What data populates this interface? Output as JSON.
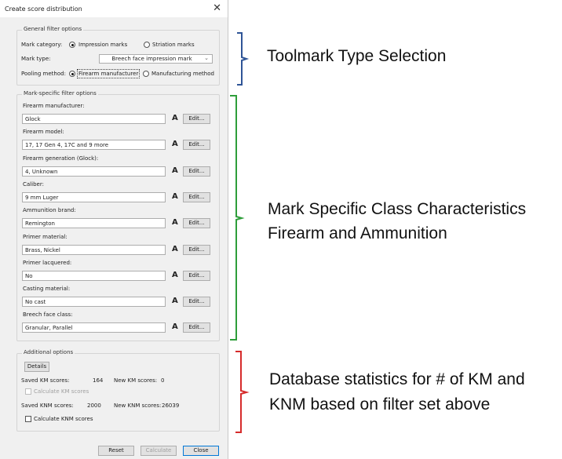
{
  "dialog": {
    "title": "Create score distribution",
    "general": {
      "legend": "General filter options",
      "mark_category_label": "Mark category:",
      "mark_category_options": [
        "Impression marks",
        "Striation marks"
      ],
      "mark_type_label": "Mark type:",
      "mark_type_value": "Breech face impression mark",
      "pooling_label": "Pooling method:",
      "pooling_options": [
        "Firearm manufacturer",
        "Manufacturing method"
      ]
    },
    "mark_specific": {
      "legend": "Mark-specific filter options",
      "edit_label": "Edit...",
      "a_glyph": "A",
      "fields": [
        {
          "label": "Firearm manufacturer:",
          "value": "Glock"
        },
        {
          "label": "Firearm model:",
          "value": "17, 17 Gen 4, 17C and 9 more"
        },
        {
          "label": "Firearm generation (Glock):",
          "value": "4, Unknown"
        },
        {
          "label": "Caliber:",
          "value": "9 mm Luger"
        },
        {
          "label": "Ammunition brand:",
          "value": "Remington"
        },
        {
          "label": "Primer material:",
          "value": "Brass, Nickel"
        },
        {
          "label": "Primer lacquered:",
          "value": "No"
        },
        {
          "label": "Casting material:",
          "value": "No cast"
        },
        {
          "label": "Breech face class:",
          "value": "Granular, Parallel"
        }
      ]
    },
    "additional": {
      "legend": "Additional options",
      "details_button": "Details",
      "saved_km_label": "Saved KM scores:",
      "saved_km_value": "164",
      "new_km_label": "New KM scores:",
      "new_km_value": "0",
      "calc_km_label": "Calculate KM scores",
      "saved_knm_label": "Saved KNM scores:",
      "saved_knm_value": "2000",
      "new_knm_label": "New KNM scores:",
      "new_knm_value": "26039",
      "calc_knm_label": "Calculate KNM scores"
    },
    "footer": {
      "reset": "Reset",
      "calculate": "Calculate",
      "close": "Close"
    }
  },
  "annotations": {
    "toolmark": "Toolmark Type Selection",
    "mark_specific_line1": "Mark Specific Class Characteristics",
    "mark_specific_line2": "Firearm and Ammunition",
    "database_line1": "Database statistics for # of KM and",
    "database_line2": "KNM based on filter set above",
    "colors": {
      "blue": "#2f5597",
      "green": "#2e9e3a",
      "red": "#d62b2b"
    }
  }
}
